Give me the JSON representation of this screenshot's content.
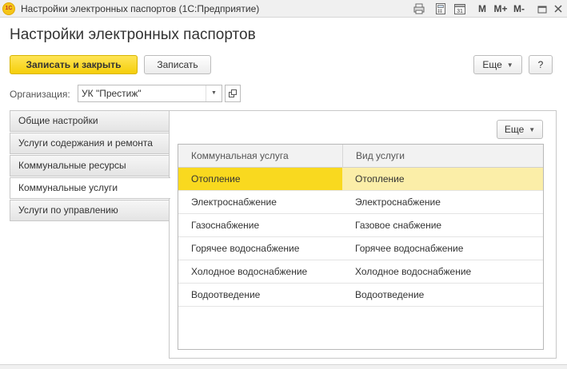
{
  "window": {
    "title": "Настройки электронных паспортов  (1С:Предприятие)",
    "logo_text": "1С",
    "toolbar": {
      "m_label": "M",
      "mplus_label": "M+",
      "mminus_label": "M-"
    }
  },
  "page": {
    "title": "Настройки электронных паспортов"
  },
  "actions": {
    "save_close_label": "Записать и закрыть",
    "save_label": "Записать",
    "more_label": "Еще",
    "help_label": "?"
  },
  "organization": {
    "label": "Организация:",
    "value": "УК \"Престиж\""
  },
  "tabs": [
    {
      "label": "Общие настройки",
      "active": false
    },
    {
      "label": "Услуги содержания и ремонта",
      "active": false
    },
    {
      "label": "Коммунальные ресурсы",
      "active": false
    },
    {
      "label": "Коммунальные услуги",
      "active": true
    },
    {
      "label": "Услуги по управлению",
      "active": false
    }
  ],
  "panel": {
    "more_label": "Еще"
  },
  "table": {
    "columns": [
      "Коммунальная услуга",
      "Вид услуги"
    ],
    "rows": [
      [
        "Отопление",
        "Отопление"
      ],
      [
        "Электроснабжение",
        "Электроснабжение"
      ],
      [
        "Газоснабжение",
        "Газовое снабжение"
      ],
      [
        "Горячее водоснабжение",
        "Горячее водоснабжение"
      ],
      [
        "Холодное водоснабжение",
        "Холодное водоснабжение"
      ],
      [
        "Водоотведение",
        "Водоотведение"
      ]
    ],
    "selected_row": 0
  },
  "colors": {
    "accent": "#f5ce0a",
    "selected_cell": "#f9d91f",
    "selected_cell_light": "#fbeea8"
  }
}
